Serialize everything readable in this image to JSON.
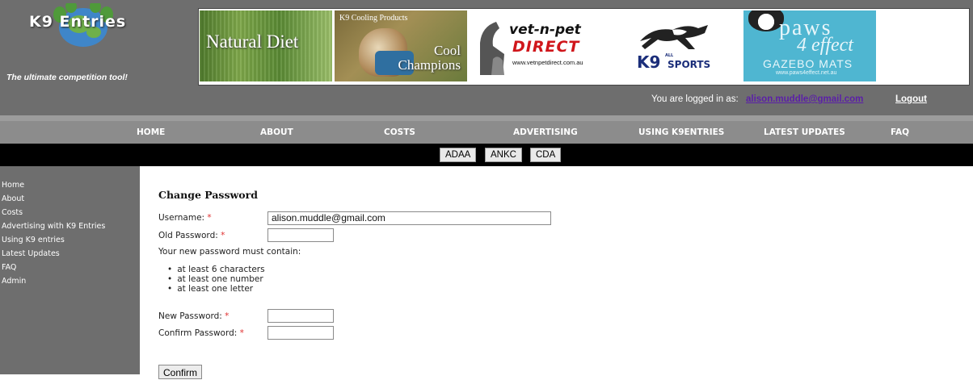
{
  "brand": {
    "name": "K9 Entries",
    "tagline": "The ultimate competition tool!"
  },
  "ads": {
    "natural_diet": "Natural Diet",
    "cool_champions_small": "K9 Cooling Products",
    "cool_champions_line1": "Cool",
    "cool_champions_line2": "Champions",
    "vetnpet_line1": "vet-n-pet",
    "vetnpet_line2": "DIRECT",
    "vetnpet_url": "www.vetnpetdirect.com.au",
    "k9sports_k9": "K9",
    "k9sports_all": "ALL",
    "k9sports_sports": "SPORTS",
    "paws_line1": "paws",
    "paws_line2": "4 effect",
    "paws_line3": "GAZEBO MATS",
    "paws_url": "www.paws4effect.net.au"
  },
  "session": {
    "logged_in_label": "You are logged in as:",
    "email": "alison.muddle@gmail.com",
    "logout": "Logout"
  },
  "nav": [
    "HOME",
    "ABOUT",
    "COSTS",
    "ADVERTISING",
    "USING K9ENTRIES",
    "LATEST UPDATES",
    "FAQ"
  ],
  "subnav": [
    "ADAA",
    "ANKC",
    "CDA"
  ],
  "sidebar": [
    "Home",
    "About",
    "Costs",
    "Advertising with K9 Entries",
    "Using K9 entries",
    "Latest Updates",
    "FAQ",
    "Admin"
  ],
  "form": {
    "title": "Change Password",
    "username_label": "Username:",
    "username_value": "alison.muddle@gmail.com",
    "old_password_label": "Old Password:",
    "rules_intro": "Your new password must contain:",
    "rules": [
      "at least 6 characters",
      "at least one number",
      "at least one letter"
    ],
    "new_password_label": "New Password:",
    "confirm_password_label": "Confirm Password:",
    "required_mark": "*",
    "confirm_button": "Confirm"
  },
  "colors": {
    "header_bg": "#6e6e6e",
    "nav_bg": "#8c8c8c",
    "subnav_bg": "#000000",
    "email_link": "#5b1fa8",
    "required": "#e03030"
  }
}
